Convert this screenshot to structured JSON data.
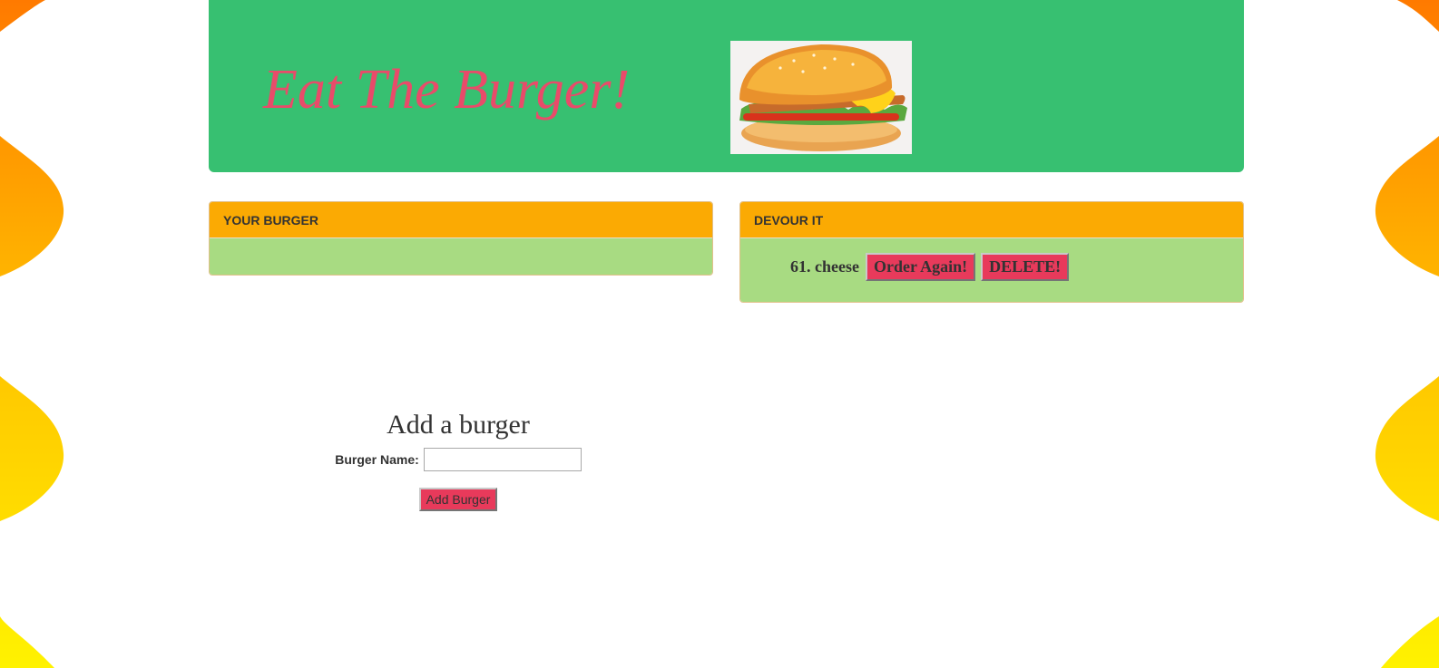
{
  "header": {
    "title": "Eat The Burger!",
    "logo_icon": "burger-illustration"
  },
  "panels": {
    "your_burger": {
      "heading": "YOUR BURGER",
      "items": []
    },
    "devour_it": {
      "heading": "DEVOUR IT",
      "items": [
        {
          "label": "61. cheese",
          "order_again_label": "Order Again!",
          "delete_label": "DELETE!"
        }
      ]
    }
  },
  "add_form": {
    "title": "Add a burger",
    "field_label": "Burger Name:",
    "input_value": "",
    "submit_label": "Add Burger"
  },
  "colors": {
    "header_bg": "#37c071",
    "title": "#e94b6a",
    "panel_heading": "#fbaa03",
    "panel_body": "#a8db82",
    "button": "#e83a5b",
    "background_wave_orange": "#ff7a00",
    "background_wave_yellow": "#fff200"
  }
}
